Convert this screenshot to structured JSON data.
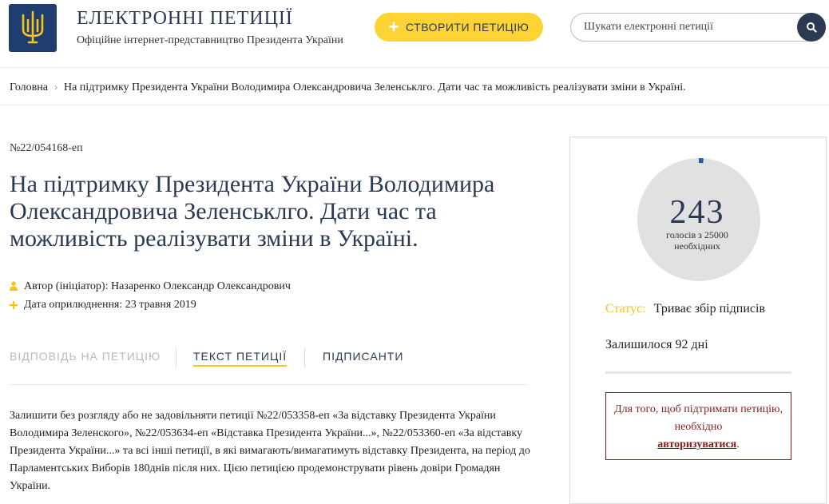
{
  "header": {
    "title": "ЕЛЕКТРОННІ ПЕТИЦІЇ",
    "subtitle": "Офіційне інтернет-представництво Президента України",
    "create_label": "СТВОРИТИ ПЕТИЦІЮ",
    "search_placeholder": "Шукати електронні петиції"
  },
  "breadcrumb": {
    "home": "Головна",
    "current": "На підтримку Президента України Володимира Олександровича Зеленськлго. Дати час та можливість реалізувати зміни в Україні."
  },
  "petition": {
    "number": "№22/054168-еп",
    "title": "На підтримку Президента України Володимира Олександровича Зеленськлго. Дати час та можливість реалізувати зміни в Україні.",
    "author": "Автор (ініціатор): Назаренко Олександр Олександрович",
    "date": "Дата оприлюднення: 23 травня 2019",
    "body": "Залишити без розгляду або не задовільняти петиції №22/053358-еп «За відставку Президента України Володимира Зеленского», №22/053634-еп «Відставка Президента України...», №22/053360-еп «За відставку Президента України...» та всі інші петиції, в які вимагають/вимагатимуть відставку Президента, на період до Парламентських Виборів 180днів після них. Цією петицією продемонструвати рівень довіри Громадян України."
  },
  "tabs": {
    "answer": "ВІДПОВІДЬ НА ПЕТИЦІЮ",
    "text": "ТЕКСТ ПЕТИЦІЇ",
    "signers": "ПІДПИСАНТИ"
  },
  "sidebar": {
    "votes": 243,
    "votes_needed": 25000,
    "count_display": "243",
    "count_caption": "голосів з 25000 необхідних",
    "status_label": "Статус:",
    "status_value": "Триває збір підписів",
    "remaining": "Залишилося 92 дні",
    "login_text": "Для того, щоб підтримати петицію, необхідно",
    "login_link": "авторизуватися",
    "login_suffix": "."
  },
  "colors": {
    "brand_navy": "#2b3a52",
    "accent_yellow": "#fdd433",
    "login_red": "#8b1a1a",
    "progress_blue": "#1b5ea8"
  }
}
